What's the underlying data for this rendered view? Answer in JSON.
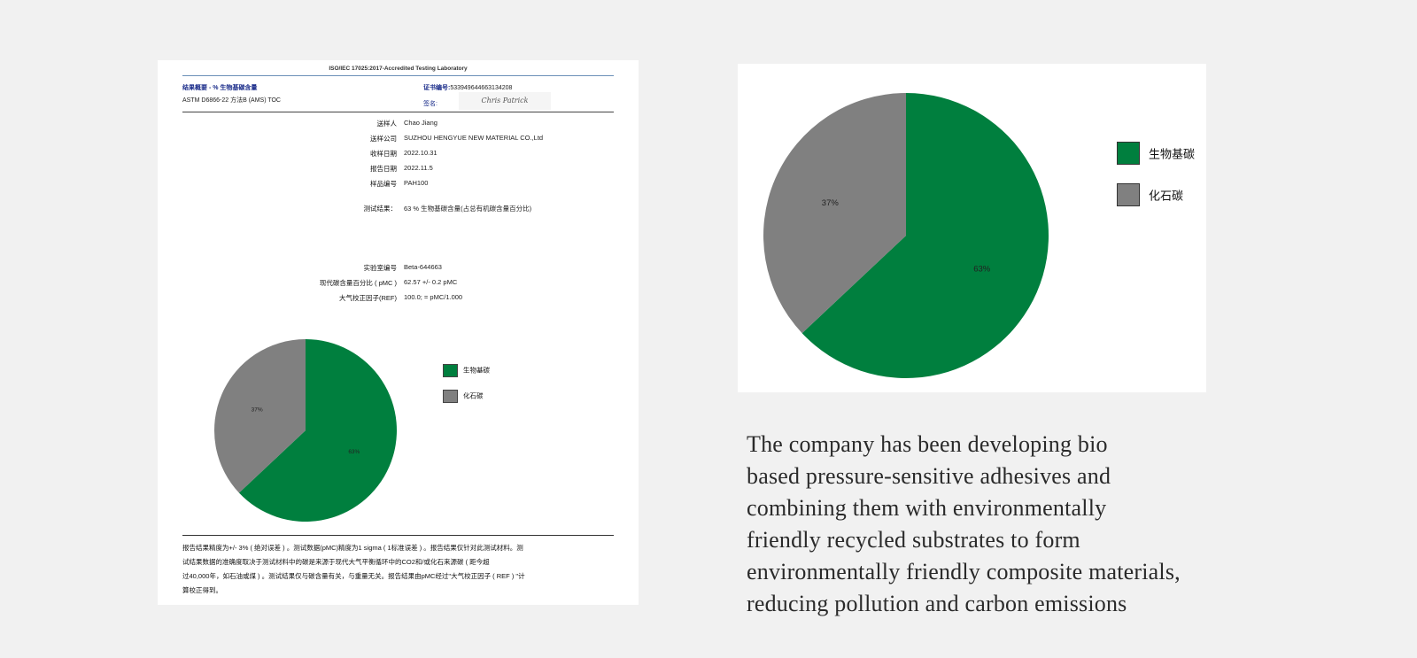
{
  "report": {
    "lab_header": "ISO/IEC 17025:2017-Accredited Testing Laboratory",
    "result_title": "结果概要 - % 生物基碳含量",
    "method": "ASTM D6866-22 方法B (AMS) TOC",
    "cert_label": "证书编号:",
    "cert_number": "533949644663134208",
    "sign_label": "签名:",
    "signature": "Chris Patrick",
    "fields": [
      {
        "label": "送样人",
        "value": "Chao Jiang"
      },
      {
        "label": "送样公司",
        "value": "SUZHOU HENGYUE NEW MATERIAL CO.,Ltd"
      },
      {
        "label": "收样日期",
        "value": "2022.10.31"
      },
      {
        "label": "报告日期",
        "value": "2022.11.5"
      },
      {
        "label": "样品编号",
        "value": "PAH100"
      }
    ],
    "test_result": {
      "label": "测试结果：",
      "value": "63 % 生物基碳含量(占总有机碳含量百分比)"
    },
    "lab_fields": [
      {
        "label": "实验室编号",
        "value": "Beta-644663"
      },
      {
        "label": "现代碳含量百分比 ( pMC )",
        "value": "62.57 +/- 0.2 pMC"
      },
      {
        "label": "大气校正因子(REF)",
        "value": "100.0; = pMC/1.000"
      }
    ],
    "note_lines": [
      "报告结果精度为+/- 3% ( 绝对误差 ) 。测试数据(pMC)精度为1 sigma ( 1标准误差 ) 。报告结果仅针对此测试材料。测",
      "试结果数据的准确度取决于测试材料中的碳是来源于现代大气平衡循环中的CO2和/或化石来源碳 ( 距今超",
      "过40,000年，如石油或煤 ) 。测试结果仅与碳含量有关，与重量无关。报告结果由pMC经过\"大气校正因子 ( REF ) \"计",
      "算校正得到。"
    ]
  },
  "chart_data": [
    {
      "type": "pie",
      "categories": [
        "生物基碳",
        "化石碳"
      ],
      "values": [
        63,
        37
      ],
      "data_labels": [
        "63%",
        "37%"
      ],
      "colors": [
        "#007f3e",
        "#808080"
      ],
      "legend": "right"
    },
    {
      "type": "pie",
      "categories": [
        "生物基碳",
        "化石碳"
      ],
      "values": [
        63,
        37
      ],
      "data_labels": [
        "63%",
        "37%"
      ],
      "colors": [
        "#007f3e",
        "#808080"
      ],
      "legend": "right"
    }
  ],
  "caption_lines": [
    "The company has been developing bio",
    "based pressure-sensitive adhesives and",
    "combining them with environmentally",
    "friendly recycled substrates to form",
    "environmentally friendly composite materials,",
    "reducing pollution and carbon emissions"
  ]
}
